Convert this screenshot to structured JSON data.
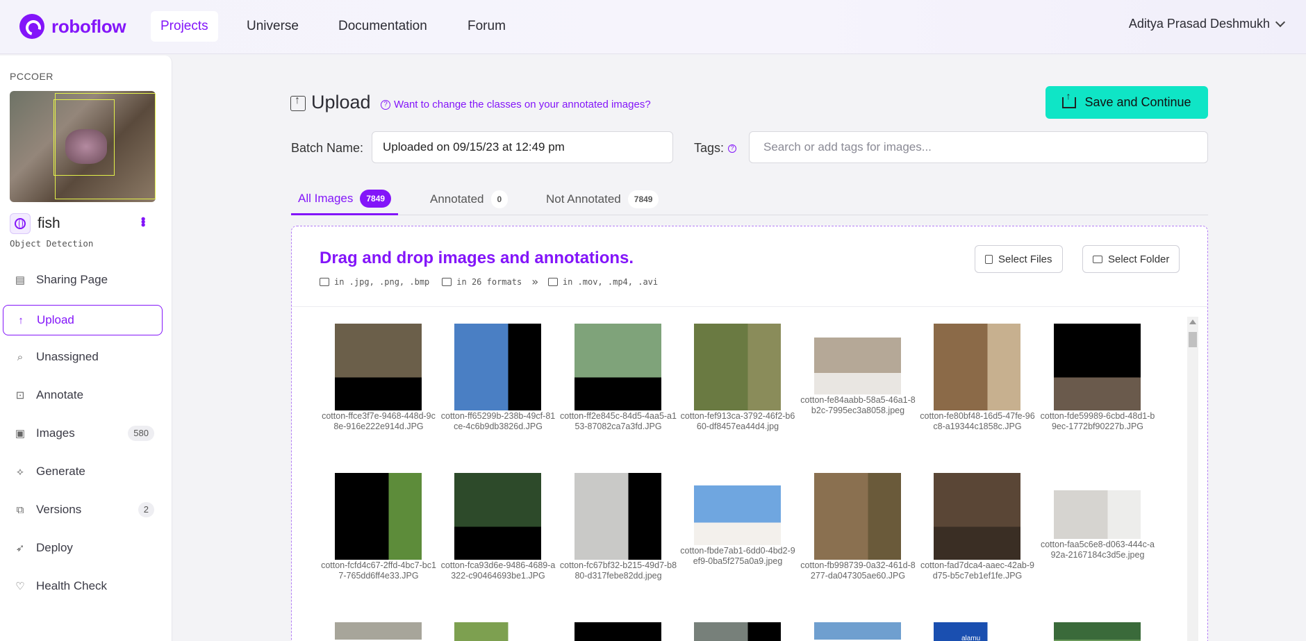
{
  "nav": {
    "brand": "roboflow",
    "items": [
      {
        "label": "Projects",
        "active": true
      },
      {
        "label": "Universe"
      },
      {
        "label": "Documentation"
      },
      {
        "label": "Forum"
      }
    ],
    "user": "Aditya Prasad Deshmukh"
  },
  "sidebar": {
    "workspace": "PCCOER",
    "project_name": "fish",
    "project_type": "Object Detection",
    "items": [
      {
        "label": "Sharing Page",
        "icon": "page-icon"
      },
      {
        "label": "Upload",
        "icon": "upload-arrow-icon",
        "active": true
      },
      {
        "label": "Unassigned",
        "icon": "search-icon"
      },
      {
        "label": "Annotate",
        "icon": "annotate-icon"
      },
      {
        "label": "Images",
        "icon": "images-icon",
        "badge": "580"
      },
      {
        "label": "Generate",
        "icon": "generate-icon"
      },
      {
        "label": "Versions",
        "icon": "versions-icon",
        "badge": "2"
      },
      {
        "label": "Deploy",
        "icon": "rocket-icon"
      },
      {
        "label": "Health Check",
        "icon": "heart-pulse-icon"
      }
    ]
  },
  "main": {
    "title": "Upload",
    "help_link": "Want to change the classes on your annotated images?",
    "save_button": "Save and Continue",
    "batch_label": "Batch Name:",
    "batch_value": "Uploaded on 09/15/23 at 12:49 pm",
    "tags_label": "Tags:",
    "tags_placeholder": "Search or add tags for images...",
    "tabs": [
      {
        "label": "All Images",
        "count": "7849",
        "active": true
      },
      {
        "label": "Annotated",
        "count": "0"
      },
      {
        "label": "Not Annotated",
        "count": "7849"
      }
    ],
    "dropzone": {
      "title": "Drag and drop images and annotations.",
      "formats": [
        "in .jpg, .png, .bmp",
        "in 26 formats",
        "in .mov, .mp4, .avi"
      ],
      "select_files": "Select Files",
      "select_folder": "Select Folder"
    },
    "images": [
      {
        "caption": "cotton-ffce3f7e-9468-448d-9c8e-916e222e914d.JPG",
        "colors": [
          "#6b5f4a",
          "#000000"
        ]
      },
      {
        "caption": "cotton-ff65299b-238b-49cf-81ce-4c6b9db3826d.JPG",
        "colors": [
          "#4a7fc4",
          "#000000"
        ]
      },
      {
        "caption": "cotton-ff2e845c-84d5-4aa5-a153-87082ca7a3fd.JPG",
        "colors": [
          "#7fa37a",
          "#000000"
        ]
      },
      {
        "caption": "cotton-fef913ca-3792-46f2-b660-df8457ea44d4.jpg",
        "colors": [
          "#6a7a42",
          "#8a8c5a"
        ]
      },
      {
        "caption": "cotton-fe84aabb-58a5-46a1-8b2c-7995ec3a8058.jpeg",
        "colors": [
          "#b5a897",
          "#e9e6e2"
        ]
      },
      {
        "caption": "cotton-fe80bf48-16d5-47fe-96c8-a19344c1858c.JPG",
        "colors": [
          "#8b6a48",
          "#c7b08f"
        ]
      },
      {
        "caption": "cotton-fde59989-6cbd-48d1-b9ec-1772bf90227b.JPG",
        "colors": [
          "#000000",
          "#6a5a4c"
        ]
      },
      {
        "caption": "cotton-fcfd4c67-2ffd-4bc7-bc17-765dd6ff4e33.JPG",
        "colors": [
          "#000000",
          "#5d8c3a"
        ]
      },
      {
        "caption": "cotton-fca93d6e-9486-4689-a322-c90464693be1.JPG",
        "colors": [
          "#2d4a2a",
          "#000000"
        ]
      },
      {
        "caption": "cotton-fc67bf32-b215-49d7-b880-d317febe82dd.jpeg",
        "colors": [
          "#c9c9c7",
          "#000000"
        ]
      },
      {
        "caption": "cotton-fbde7ab1-6dd0-4bd2-9ef9-0ba5f275a0a9.jpeg",
        "colors": [
          "#6fa6e0",
          "#f3f0ec"
        ]
      },
      {
        "caption": "cotton-fb998739-0a32-461d-8277-da047305ae60.JPG",
        "colors": [
          "#8a7050",
          "#6a5a3a"
        ]
      },
      {
        "caption": "cotton-fad7dca4-aaec-42ab-9d75-b5c7eb1ef1fe.JPG",
        "colors": [
          "#5a4636",
          "#3a2e24"
        ]
      },
      {
        "caption": "cotton-faa5c6e8-d063-444c-a92a-2167184c3d5e.jpeg",
        "colors": [
          "#d6d4d0",
          "#ededeb"
        ]
      },
      {
        "caption": "",
        "colors": [
          "#a7a59a",
          "#ffffff"
        ]
      },
      {
        "caption": "",
        "colors": [
          "#7da050",
          "#ffffff"
        ]
      },
      {
        "caption": "",
        "colors": [
          "#000000",
          "#000000"
        ]
      },
      {
        "caption": "",
        "colors": [
          "#77807a",
          "#000000"
        ]
      },
      {
        "caption": "",
        "colors": [
          "#6f9fcf",
          "#ffffff"
        ]
      },
      {
        "caption": "",
        "colors": [
          "#1a4fb0",
          "#ffffff"
        ]
      },
      {
        "caption": "",
        "colors": [
          "#3a6a3a",
          "#6a9a5a"
        ]
      }
    ],
    "image_footer_labels": [
      "alamu"
    ]
  }
}
